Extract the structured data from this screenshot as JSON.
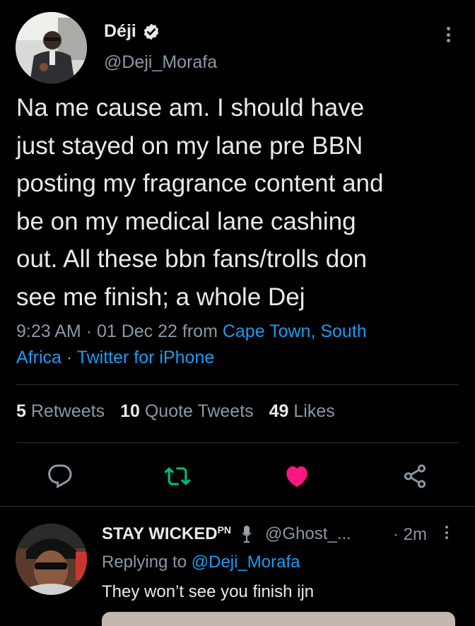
{
  "tweet": {
    "author_name": "Déji",
    "author_handle": "@Deji_Morafa",
    "verified": true,
    "text_lines": [
      "Na me cause am. I should have",
      "just stayed on my lane pre BBN",
      "posting my fragrance content and",
      "be on my medical lane cashing",
      "out. All these bbn fans/trolls don",
      "see me finish; a whole Dej"
    ],
    "time": "9:23 AM",
    "separator": "·",
    "date": "01 Dec 22",
    "from_label": "from",
    "location_part1": "Cape Town, South",
    "location_part2": "Africa",
    "source": "Twitter for iPhone",
    "retweets": "5",
    "retweets_label": "Retweets",
    "quotes": "10",
    "quotes_label": "Quote Tweets",
    "likes": "49",
    "likes_label": "Likes"
  },
  "colors": {
    "background": "#000000",
    "text": "#e7e9ea",
    "muted": "#8b98a5",
    "link": "#1d9bf0",
    "retweet": "#00ba7c",
    "like": "#f91880"
  },
  "reply": {
    "author_name": "STAY WICKED",
    "superscript": "PN",
    "handle": "@Ghost_...",
    "time": "· 2m",
    "replying_prefix": "Replying to",
    "replying_handle": "@Deji_Morafa",
    "text": "They won’t see you finish ijn"
  }
}
